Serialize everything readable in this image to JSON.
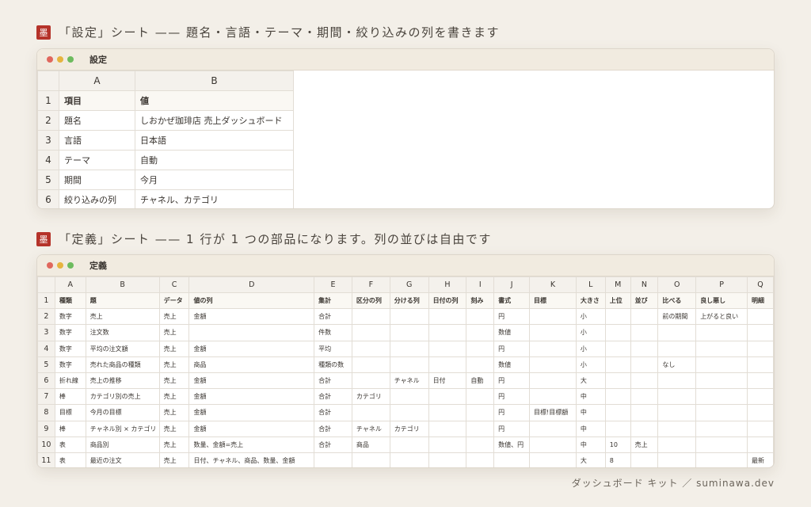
{
  "section1": {
    "badge": "墨",
    "title": "「設定」シート —— 題名・言語・テーマ・期間・絞り込みの列を書きます",
    "window_title": "設定",
    "columns": [
      "A",
      "B"
    ],
    "rows": [
      [
        "項目",
        "値"
      ],
      [
        "題名",
        "しおかぜ珈琲店 売上ダッシュボード"
      ],
      [
        "言語",
        "日本語"
      ],
      [
        "テーマ",
        "自動"
      ],
      [
        "期間",
        "今月"
      ],
      [
        "絞り込みの列",
        "チャネル、カテゴリ"
      ]
    ]
  },
  "section2": {
    "badge": "墨",
    "title": "「定義」シート —— 1 行が 1 つの部品になります。列の並びは自由です",
    "window_title": "定義",
    "columns": [
      "A",
      "B",
      "C",
      "D",
      "E",
      "F",
      "G",
      "H",
      "I",
      "J",
      "K",
      "L",
      "M",
      "N",
      "O",
      "P",
      "Q"
    ],
    "rows": [
      [
        "種類",
        "題",
        "データ",
        "値の列",
        "集計",
        "区分の列",
        "分ける列",
        "日付の列",
        "刻み",
        "書式",
        "目標",
        "大きさ",
        "上位",
        "並び",
        "比べる",
        "良し悪し",
        "明細"
      ],
      [
        "数字",
        "売上",
        "売上",
        "金額",
        "合計",
        "",
        "",
        "",
        "",
        "円",
        "",
        "小",
        "",
        "",
        "前の期間",
        "上がると良い",
        ""
      ],
      [
        "数字",
        "注文数",
        "売上",
        "",
        "件数",
        "",
        "",
        "",
        "",
        "数値",
        "",
        "小",
        "",
        "",
        "",
        "",
        ""
      ],
      [
        "数字",
        "平均の注文額",
        "売上",
        "金額",
        "平均",
        "",
        "",
        "",
        "",
        "円",
        "",
        "小",
        "",
        "",
        "",
        "",
        ""
      ],
      [
        "数字",
        "売れた商品の種類",
        "売上",
        "商品",
        "種類の数",
        "",
        "",
        "",
        "",
        "数値",
        "",
        "小",
        "",
        "",
        "なし",
        "",
        ""
      ],
      [
        "折れ線",
        "売上の推移",
        "売上",
        "金額",
        "合計",
        "",
        "チャネル",
        "日付",
        "自動",
        "円",
        "",
        "大",
        "",
        "",
        "",
        "",
        ""
      ],
      [
        "棒",
        "カテゴリ別の売上",
        "売上",
        "金額",
        "合計",
        "カテゴリ",
        "",
        "",
        "",
        "円",
        "",
        "中",
        "",
        "",
        "",
        "",
        ""
      ],
      [
        "目標",
        "今月の目標",
        "売上",
        "金額",
        "合計",
        "",
        "",
        "",
        "",
        "円",
        "目標!目標額",
        "中",
        "",
        "",
        "",
        "",
        ""
      ],
      [
        "棒",
        "チャネル別 × カテゴリ",
        "売上",
        "金額",
        "合計",
        "チャネル",
        "カテゴリ",
        "",
        "",
        "円",
        "",
        "中",
        "",
        "",
        "",
        "",
        ""
      ],
      [
        "表",
        "商品別",
        "売上",
        "数量、金額=売上",
        "合計",
        "商品",
        "",
        "",
        "",
        "数値、円",
        "",
        "中",
        "10",
        "売上",
        "",
        "",
        ""
      ],
      [
        "表",
        "最近の注文",
        "売上",
        "日付、チャネル、商品、数量、金額",
        "",
        "",
        "",
        "",
        "",
        "",
        "",
        "大",
        "8",
        "",
        "",
        "",
        "最新"
      ]
    ]
  },
  "footer": "ダッシュボード キット ／ suminawa.dev"
}
